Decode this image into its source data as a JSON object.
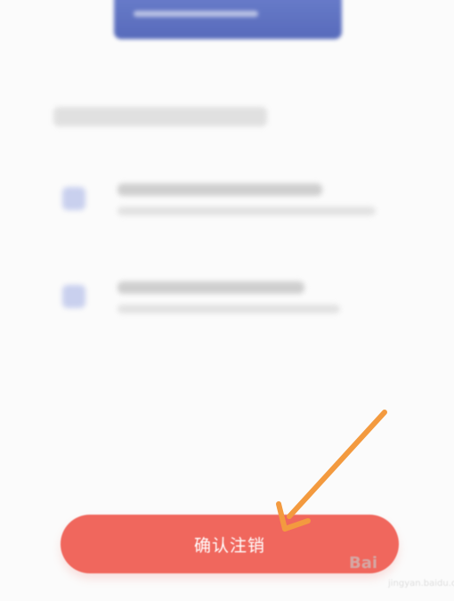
{
  "confirm_button": {
    "label": "确认注销"
  },
  "colors": {
    "banner": "#4a5fb6",
    "confirm_button": "#f0675d",
    "arrow": "#f39a3f",
    "background": "#fbfbfb"
  },
  "icons": [
    "document-icon",
    "wallet-icon",
    "annotation-arrow-icon",
    "watermark-logo"
  ],
  "watermark": {
    "brand": "Bai",
    "sub": "jingyan.baidu.com"
  }
}
